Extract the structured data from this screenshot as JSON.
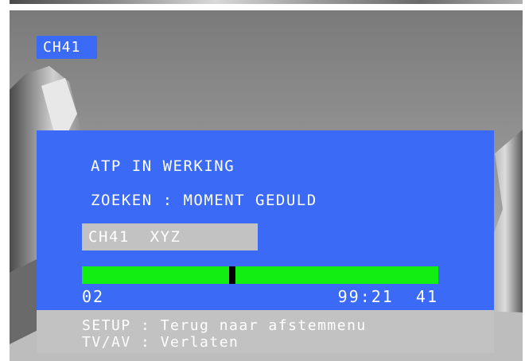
{
  "channel_badge": "CH41",
  "atp_panel": {
    "status": "ATP IN WERKING",
    "search": "ZOEKEN : MOMENT GEDULD",
    "station": "CH41  XYZ",
    "tuning_progress": 0.42,
    "band_start": "02",
    "frequency_readout": "99:21  41"
  },
  "help": {
    "line1": "SETUP : Terug naar afstemmenu",
    "line2": "TV/AV : Verlaten"
  },
  "colors": {
    "osd_blue": "#3a6af6",
    "osd_grey": "#c2c2c2",
    "tuning_green": "#12ee12",
    "text": "#ffffff"
  }
}
